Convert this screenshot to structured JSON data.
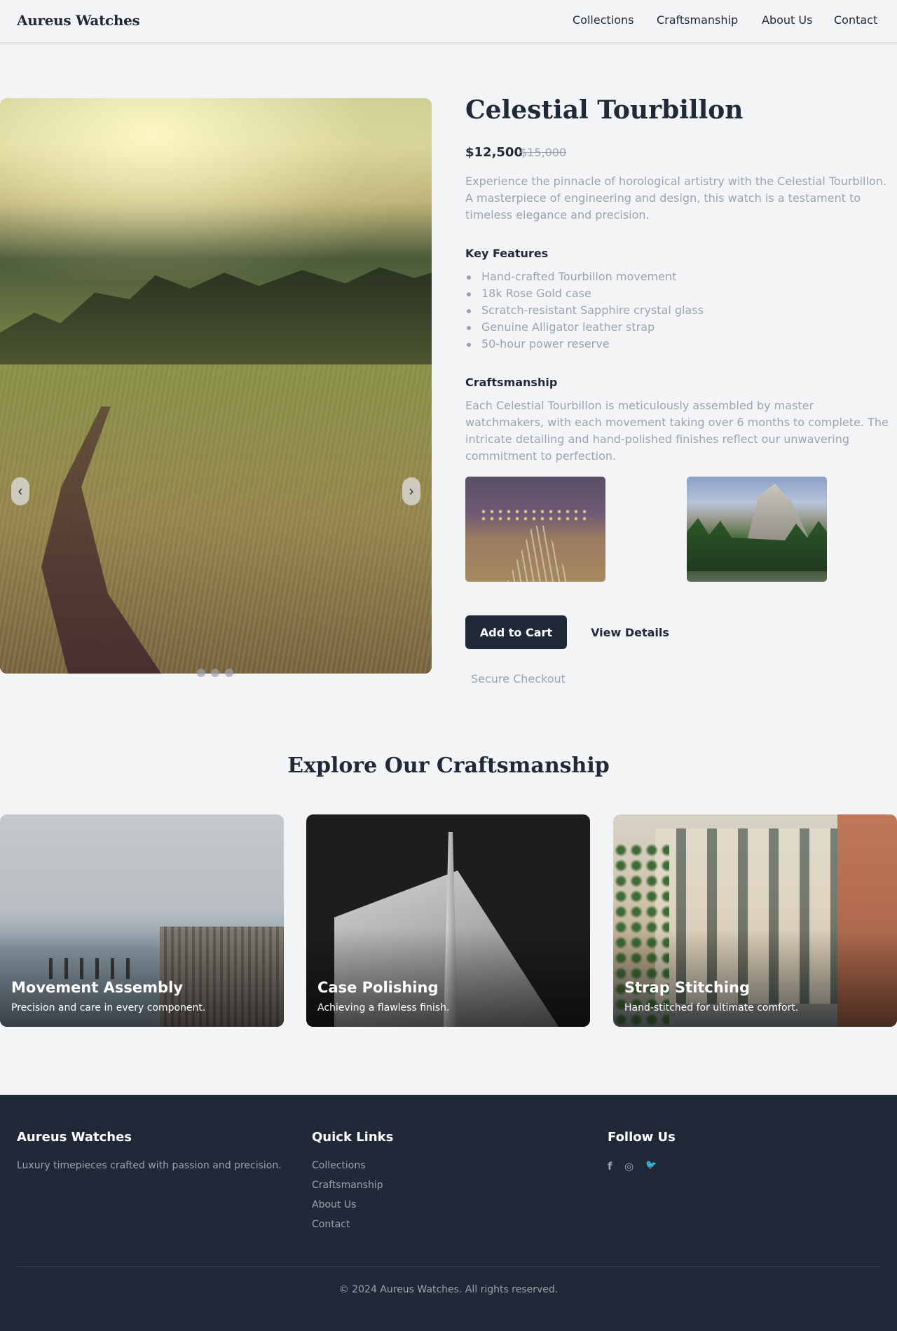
{
  "header": {
    "brand": "Aureus Watches",
    "nav": [
      "Collections",
      "Craftsmanship",
      "About Us",
      "Contact"
    ]
  },
  "carousel": {
    "prev_icon": "chevron-left-icon",
    "next_icon": "chevron-right-icon",
    "prev_glyph": "‹",
    "next_glyph": "›",
    "slide_count": 3,
    "active_index": 0
  },
  "product": {
    "title": "Celestial Tourbillon",
    "price": "$12,500",
    "old_price": "$15,000",
    "description": "Experience the pinnacle of horological artistry with the Celestial Tourbillon. A masterpiece of engineering and design, this watch is a testament to timeless elegance and precision.",
    "features_heading": "Key Features",
    "features": [
      "Hand-crafted Tourbillon movement",
      "18k Rose Gold case",
      "Scratch-resistant Sapphire crystal glass",
      "Genuine Alligator leather strap",
      "50-hour power reserve"
    ],
    "craft_heading": "Craftsmanship",
    "craft_text": "Each Celestial Tourbillon is meticulously assembled by master watchmakers, with each movement taking over 6 months to complete. The intricate detailing and hand-polished finishes reflect our unwavering commitment to perfection.",
    "add_to_cart": "Add to Cart",
    "view_details": "View Details",
    "secure_checkout": "Secure Checkout"
  },
  "explore": {
    "title": "Explore Our Craftsmanship",
    "cards": [
      {
        "title": "Movement Assembly",
        "subtitle": "Precision and care in every component."
      },
      {
        "title": "Case Polishing",
        "subtitle": "Achieving a flawless finish."
      },
      {
        "title": "Strap Stitching",
        "subtitle": "Hand-stitched for ultimate comfort."
      }
    ]
  },
  "footer": {
    "brand": "Aureus Watches",
    "tagline": "Luxury timepieces crafted with passion and precision.",
    "quick_links_heading": "Quick Links",
    "quick_links": [
      "Collections",
      "Craftsmanship",
      "About Us",
      "Contact"
    ],
    "follow_heading": "Follow Us",
    "social": [
      {
        "icon": "facebook-icon",
        "glyph": "f"
      },
      {
        "icon": "instagram-icon",
        "glyph": "◎"
      },
      {
        "icon": "twitter-icon",
        "glyph": "🐦"
      }
    ],
    "copyright": "© 2024 Aureus Watches. All rights reserved."
  },
  "colors": {
    "background": "#f3f4f6",
    "primary_dark": "#1f2937",
    "muted_text": "#9ca3af",
    "white": "#ffffff"
  }
}
